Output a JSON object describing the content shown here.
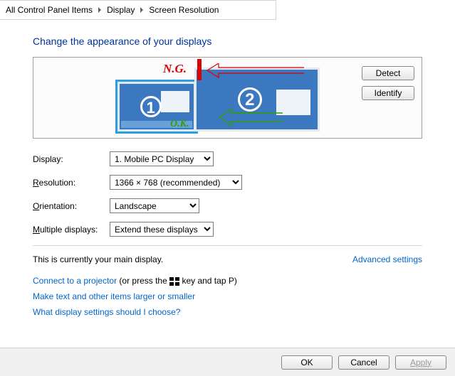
{
  "breadcrumb": {
    "items": [
      "All Control Panel Items",
      "Display",
      "Screen Resolution"
    ]
  },
  "title": "Change the appearance of your displays",
  "preview": {
    "monitor1_num": "1",
    "monitor2_num": "2",
    "detect_label": "Detect",
    "identify_label": "Identify",
    "annotation_ng": "N.G.",
    "annotation_ok": "O.K."
  },
  "form": {
    "display_label": "Display:",
    "display_value": "1. Mobile PC Display",
    "resolution_label": "esolution:",
    "resolution_prefix": "R",
    "resolution_value": "1366 × 768 (recommended)",
    "orientation_label": "rientation:",
    "orientation_prefix": "O",
    "orientation_value": "Landscape",
    "multiple_label": "ultiple displays:",
    "multiple_prefix": "M",
    "multiple_value": "Extend these displays"
  },
  "main_display_text": "This is currently your main display.",
  "advanced_link": "Advanced settings",
  "links": {
    "projector_link": "Connect to a projector",
    "projector_suffix_a": " (or press the ",
    "projector_suffix_b": " key and tap P)",
    "larger_link": "Make text and other items larger or smaller",
    "help_link": "What display settings should I choose?"
  },
  "footer": {
    "ok": "OK",
    "cancel": "Cancel",
    "apply": "Apply"
  }
}
